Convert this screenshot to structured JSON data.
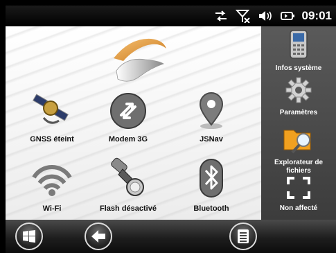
{
  "status": {
    "time": "09:01"
  },
  "apps": [
    {
      "label": "GNSS éteint"
    },
    {
      "label": "Modem 3G"
    },
    {
      "label": "JSNav"
    },
    {
      "label": "Wi-Fi"
    },
    {
      "label": "Flash désactivé"
    },
    {
      "label": "Bluetooth"
    }
  ],
  "side": [
    {
      "label": "Infos système"
    },
    {
      "label": "Paramètres"
    },
    {
      "label": "Explorateur de fichiers"
    },
    {
      "label": "Non affecté"
    }
  ]
}
